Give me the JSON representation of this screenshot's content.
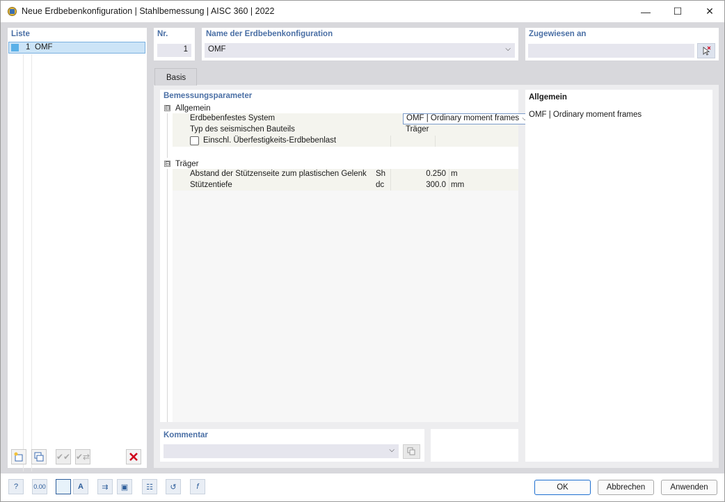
{
  "window": {
    "title": "Neue Erdbebenkonfiguration | Stahlbemessung | AISC 360 | 2022",
    "minimize_glyph": "—",
    "maximize_glyph": "☐",
    "close_glyph": "✕"
  },
  "list": {
    "label": "Liste",
    "items": [
      {
        "number": "1",
        "name": "OMF",
        "color": "#5ab0e8"
      }
    ]
  },
  "nr": {
    "label": "Nr.",
    "value": "1"
  },
  "name": {
    "label": "Name der Erdbebenkonfiguration",
    "value": "OMF"
  },
  "assigned": {
    "label": "Zugewiesen an",
    "value": ""
  },
  "tabs": [
    {
      "label": "Basis",
      "active": true
    }
  ],
  "params": {
    "label": "Bemessungsparameter",
    "groups": [
      {
        "name": "Allgemein",
        "toggle": "⊟",
        "rows": [
          {
            "name": "Erdbebenfestes System",
            "value": "OMF | Ordinary moment frames"
          },
          {
            "name": "Typ des seismischen Bauteils",
            "value": "Träger"
          },
          {
            "name": "Einschl. Überfestigkeits-Erdbebenlast",
            "checked": false
          }
        ]
      },
      {
        "name": "Träger",
        "toggle": "⊟",
        "rows": [
          {
            "name": "Abstand der Stützenseite zum plastischen Gelenk",
            "symbol": "Sh",
            "value": "0.250",
            "unit": "m"
          },
          {
            "name": "Stützentiefe",
            "symbol": "dc",
            "value": "300.0",
            "unit": "mm"
          }
        ]
      }
    ]
  },
  "info": {
    "title": "Allgemein",
    "text": "OMF | Ordinary moment frames"
  },
  "comment": {
    "label": "Kommentar",
    "value": ""
  },
  "buttons": {
    "ok": "OK",
    "cancel": "Abbrechen",
    "apply": "Anwenden"
  },
  "icons": {
    "list_new": "new-item-icon",
    "list_copy": "copy-item-icon",
    "list_check": "check-icon",
    "list_check2": "check-alt-icon",
    "list_delete": "delete-icon",
    "bottom": [
      "help-icon",
      "units-icon",
      "color-icon",
      "font-icon",
      "import-icon",
      "export-icon",
      "table-icon",
      "reset-icon",
      "formula-icon"
    ]
  },
  "colors": {
    "accent": "#4a6fa5",
    "delete": "#d0021b",
    "selection": "#cce4f7"
  }
}
